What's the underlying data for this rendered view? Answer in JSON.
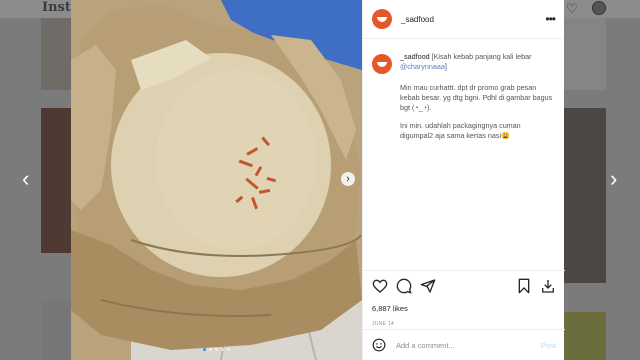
{
  "background": {
    "logo_text": "Insta"
  },
  "post": {
    "username": "_sadfood",
    "caption": {
      "username": "_sadfood",
      "text_part1": " [Kisah kebab panjang kali lebar ",
      "mention": "@charynnaaa",
      "text_part2": "]",
      "paragraph1": "Min mau curhattt. dpt dr promo grab pesan kebab besar. yg dtg bgni. Pdhl di gambar bagus bgt (◔_◔).",
      "paragraph2": "Ini min. udahlah packagingnya cuman digumpal2 aja sama kertas nasi😩"
    },
    "likes": "6,887 likes",
    "date": "JUNE 14",
    "comment_placeholder": "Add a comment...",
    "post_label": "Post"
  },
  "colors": {
    "avatar": "#e3572b",
    "link": "#5b7fc0",
    "post_button": "#b2dffc",
    "active_dot": "#2d8cf0"
  },
  "icons": [
    "more-options-icon",
    "heart-icon",
    "comment-icon",
    "share-icon",
    "bookmark-icon",
    "download-icon",
    "emoji-icon",
    "chevron-left-icon",
    "chevron-right-icon"
  ],
  "carousel": {
    "slides": 5,
    "active_index": 0
  }
}
